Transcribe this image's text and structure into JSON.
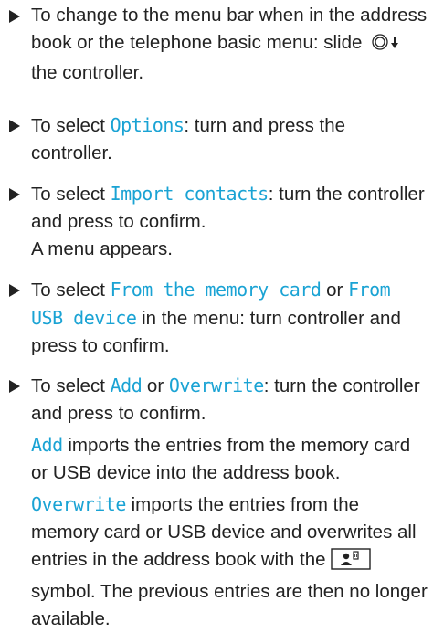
{
  "steps": [
    {
      "pre": "To change to the menu bar when in the address book or the telephone basic menu: slide ",
      "post": " the controller.",
      "icon": "controller-slide-down-icon"
    },
    {
      "pre": "To select ",
      "hl": "Options",
      "post": ": turn and press the controller."
    },
    {
      "pre": "To select ",
      "hl": "Import contacts",
      "post": ": turn the controller and press to confirm.",
      "note": "A menu appears."
    },
    {
      "pre": "To select ",
      "hl1": "From the memory card",
      "mid": " or ",
      "hl2": "From USB device",
      "post": " in the menu: turn controller and press to confirm."
    },
    {
      "pre": "To select ",
      "hl1": "Add",
      "mid": " or ",
      "hl2": "Overwrite",
      "post": ": turn the controller and press to confirm.",
      "add_hl": "Add",
      "add_text": " imports the entries from the memory card or USB device into the address book.",
      "overwrite_hl": "Overwrite",
      "overwrite_text": " imports the entries from the memory card or USB device and overwrites all entries in the address book with the ",
      "overwrite_icon": "imported-contact-symbol-icon",
      "overwrite_tail": " symbol. The previous entries are then no longer available."
    }
  ],
  "colors": {
    "highlight": "#1aa3d4",
    "text": "#222222"
  }
}
